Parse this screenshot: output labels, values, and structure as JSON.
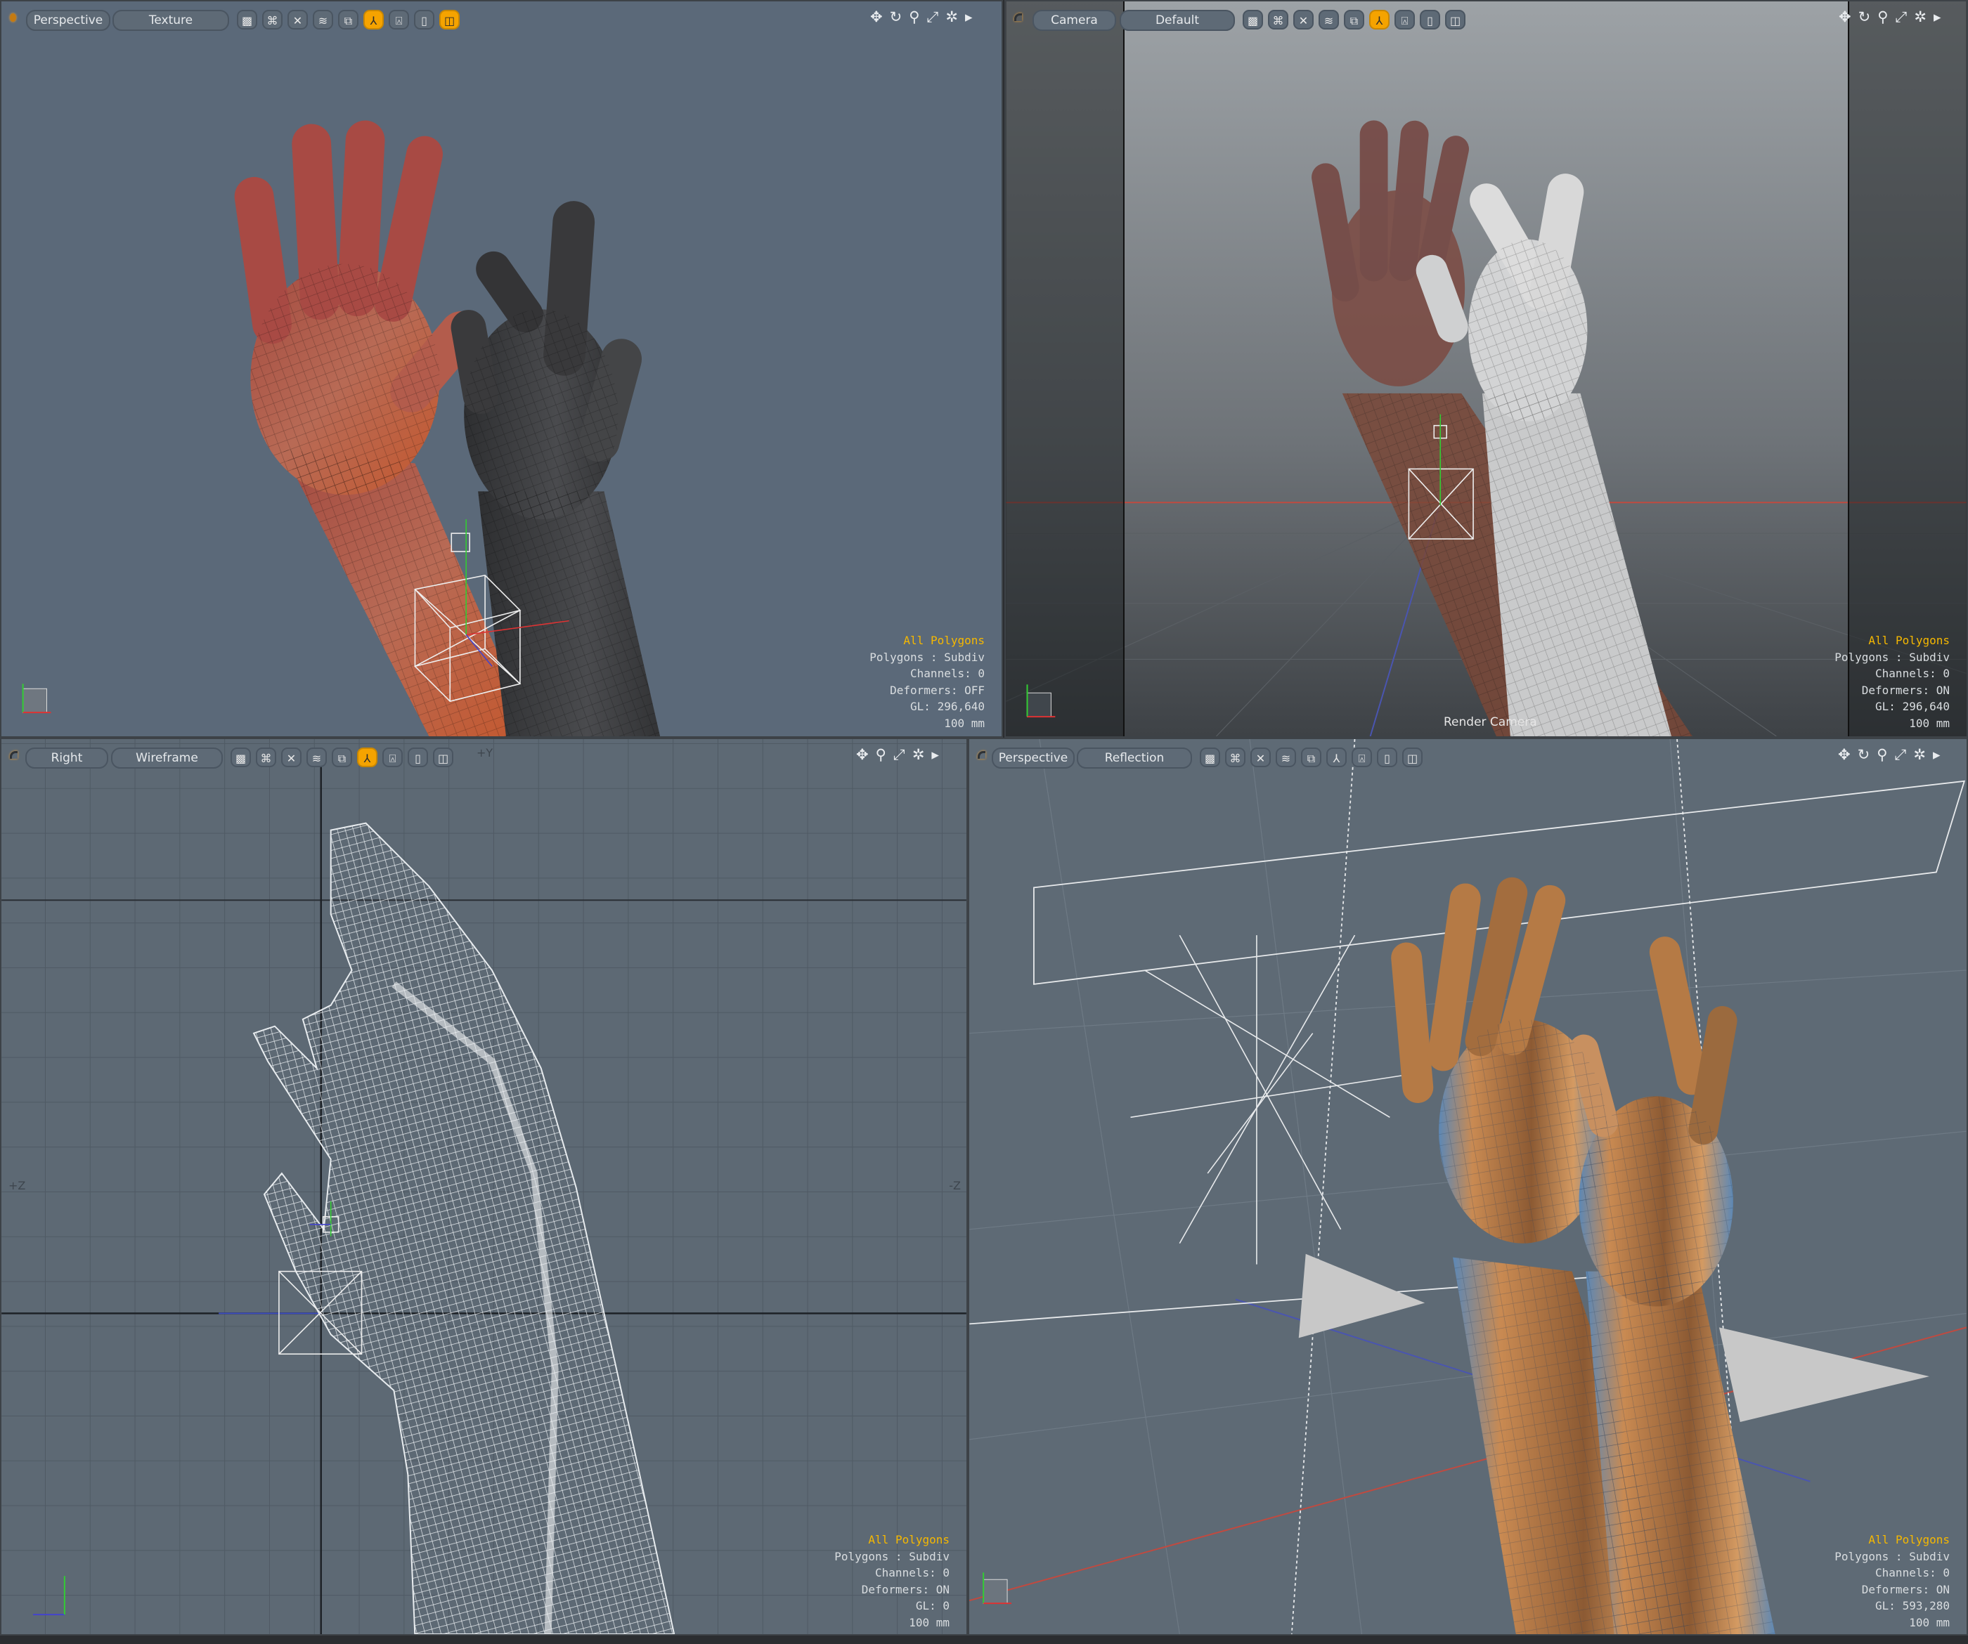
{
  "accent_color": "#f5a300",
  "viewports": [
    {
      "view_label": "Perspective",
      "shading_label": "Texture",
      "toolbar_icons": [
        {
          "name": "checker-icon",
          "glyph": "▩",
          "active": false
        },
        {
          "name": "loops-icon",
          "glyph": "⌘",
          "active": false
        },
        {
          "name": "x-shade-icon",
          "glyph": "✕",
          "active": false
        },
        {
          "name": "waves-icon",
          "glyph": "≋",
          "active": false
        },
        {
          "name": "layers-icon",
          "glyph": "⧉",
          "active": false
        },
        {
          "name": "axis-y-icon",
          "glyph": "⅄",
          "active": true
        },
        {
          "name": "figure-icon",
          "glyph": "⍓",
          "active": false
        },
        {
          "name": "ring-icon",
          "glyph": "▯",
          "active": false
        },
        {
          "name": "double-ring-icon",
          "glyph": "◫",
          "active": true
        }
      ],
      "nav_icons": [
        {
          "name": "move-icon",
          "glyph": "✥"
        },
        {
          "name": "rotate-icon",
          "glyph": "↻"
        },
        {
          "name": "zoom-icon",
          "glyph": "⚲"
        },
        {
          "name": "fit-icon",
          "glyph": "⤢"
        },
        {
          "name": "gear-icon",
          "glyph": "✲"
        },
        {
          "name": "menu-arrow-icon",
          "glyph": "▸"
        }
      ],
      "info": {
        "selection": "All Polygons",
        "polygons": "Polygons : Subdiv",
        "channels": "Channels: 0",
        "deformers": "Deformers: OFF",
        "gl": "GL: 296,640",
        "scale": "100 mm"
      }
    },
    {
      "view_label": "Camera",
      "shading_label": "Default",
      "toolbar_icons": [
        {
          "name": "checker-icon",
          "glyph": "▩",
          "active": false
        },
        {
          "name": "loops-icon",
          "glyph": "⌘",
          "active": false
        },
        {
          "name": "x-shade-icon",
          "glyph": "✕",
          "active": false
        },
        {
          "name": "waves-icon",
          "glyph": "≋",
          "active": false
        },
        {
          "name": "layers-icon",
          "glyph": "⧉",
          "active": false
        },
        {
          "name": "axis-y-icon",
          "glyph": "⅄",
          "active": true
        },
        {
          "name": "figure-icon",
          "glyph": "⍓",
          "active": false
        },
        {
          "name": "ring-icon",
          "glyph": "▯",
          "active": false
        },
        {
          "name": "double-ring-icon",
          "glyph": "◫",
          "active": false
        }
      ],
      "nav_icons": [
        {
          "name": "move-icon",
          "glyph": "✥"
        },
        {
          "name": "rotate-icon",
          "glyph": "↻"
        },
        {
          "name": "zoom-icon",
          "glyph": "⚲"
        },
        {
          "name": "fit-icon",
          "glyph": "⤢"
        },
        {
          "name": "gear-icon",
          "glyph": "✲"
        },
        {
          "name": "menu-arrow-icon",
          "glyph": "▸"
        }
      ],
      "camera_label": "Render Camera",
      "info": {
        "selection": "All Polygons",
        "polygons": "Polygons : Subdiv",
        "channels": "Channels: 0",
        "deformers": "Deformers: ON",
        "gl": "GL: 296,640",
        "scale": "100 mm"
      }
    },
    {
      "view_label": "Right",
      "shading_label": "Wireframe",
      "toolbar_icons": [
        {
          "name": "checker-icon",
          "glyph": "▩",
          "active": false
        },
        {
          "name": "loops-icon",
          "glyph": "⌘",
          "active": false
        },
        {
          "name": "x-shade-icon",
          "glyph": "✕",
          "active": false
        },
        {
          "name": "waves-icon",
          "glyph": "≋",
          "active": false
        },
        {
          "name": "layers-icon",
          "glyph": "⧉",
          "active": false
        },
        {
          "name": "axis-y-icon",
          "glyph": "⅄",
          "active": true
        },
        {
          "name": "figure-icon",
          "glyph": "⍓",
          "active": false
        },
        {
          "name": "ring-icon",
          "glyph": "▯",
          "active": false
        },
        {
          "name": "double-ring-icon",
          "glyph": "◫",
          "active": false
        }
      ],
      "nav_icons": [
        {
          "name": "move-icon",
          "glyph": "✥"
        },
        {
          "name": "zoom-icon",
          "glyph": "⚲"
        },
        {
          "name": "fit-icon",
          "glyph": "⤢"
        },
        {
          "name": "gear-icon",
          "glyph": "✲"
        },
        {
          "name": "menu-arrow-icon",
          "glyph": "▸"
        }
      ],
      "axis_labels": {
        "top": "+Y",
        "left": "+Z",
        "right": "-Z"
      },
      "info": {
        "selection": "All Polygons",
        "polygons": "Polygons : Subdiv",
        "channels": "Channels: 0",
        "deformers": "Deformers: ON",
        "gl": "GL: 0",
        "scale": "100 mm"
      }
    },
    {
      "view_label": "Perspective",
      "shading_label": "Reflection",
      "toolbar_icons": [
        {
          "name": "checker-icon",
          "glyph": "▩",
          "active": false
        },
        {
          "name": "loops-icon",
          "glyph": "⌘",
          "active": false
        },
        {
          "name": "x-shade-icon",
          "glyph": "✕",
          "active": false
        },
        {
          "name": "waves-icon",
          "glyph": "≋",
          "active": false
        },
        {
          "name": "layers-icon",
          "glyph": "⧉",
          "active": false
        },
        {
          "name": "axis-y-icon",
          "glyph": "⅄",
          "active": false
        },
        {
          "name": "figure-icon",
          "glyph": "⍓",
          "active": false
        },
        {
          "name": "ring-icon",
          "glyph": "▯",
          "active": false
        },
        {
          "name": "double-ring-icon",
          "glyph": "◫",
          "active": false
        }
      ],
      "nav_icons": [
        {
          "name": "move-icon",
          "glyph": "✥"
        },
        {
          "name": "rotate-icon",
          "glyph": "↻"
        },
        {
          "name": "zoom-icon",
          "glyph": "⚲"
        },
        {
          "name": "fit-icon",
          "glyph": "⤢"
        },
        {
          "name": "gear-icon",
          "glyph": "✲"
        },
        {
          "name": "menu-arrow-icon",
          "glyph": "▸"
        }
      ],
      "info": {
        "selection": "All Polygons",
        "polygons": "Polygons : Subdiv",
        "channels": "Channels: 0",
        "deformers": "Deformers: ON",
        "gl": "GL: 593,280",
        "scale": "100 mm"
      }
    }
  ]
}
